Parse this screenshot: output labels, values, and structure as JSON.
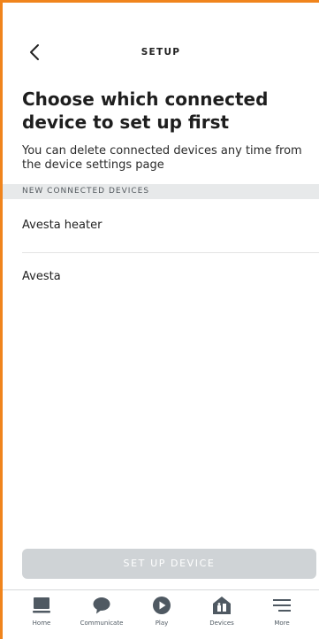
{
  "header": {
    "title": "SETUP",
    "back_icon": "chevron-left-icon"
  },
  "main": {
    "heading": "Choose which connected device to set up first",
    "description": "You can delete connected devices any time from the device settings page",
    "section_label": "NEW CONNECTED DEVICES",
    "devices": [
      {
        "name": "Avesta heater"
      },
      {
        "name": "Avesta"
      }
    ],
    "setup_button": {
      "label": "SET UP DEVICE",
      "enabled": false
    }
  },
  "bottom_nav": {
    "items": [
      {
        "label": "Home",
        "icon": "home-icon"
      },
      {
        "label": "Communicate",
        "icon": "chat-bubble-icon"
      },
      {
        "label": "Play",
        "icon": "play-icon"
      },
      {
        "label": "Devices",
        "icon": "devices-icon"
      },
      {
        "label": "More",
        "icon": "menu-icon"
      }
    ]
  },
  "colors": {
    "accent_border": "#f0841c",
    "section_bg": "#e7e9ea",
    "button_disabled": "#cfd3d6",
    "nav_icon": "#4f5962"
  }
}
